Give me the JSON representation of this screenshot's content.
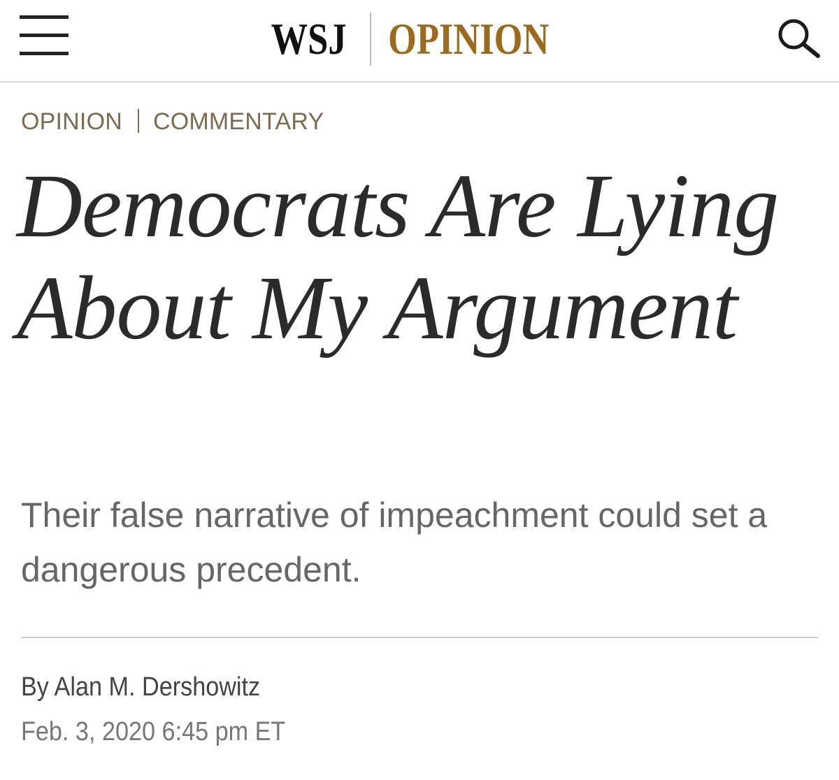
{
  "header": {
    "logo_primary": "WSJ",
    "logo_section": "OPINION",
    "menu_icon": "hamburger-menu-icon",
    "search_icon": "search-icon"
  },
  "breadcrumb": {
    "section": "OPINION",
    "subsection": "COMMENTARY"
  },
  "article": {
    "headline": "Democrats Are Lying About My Argument",
    "dek": "Their false narrative of impeachment could set a dangerous precedent.",
    "byline_prefix": "By",
    "author": "Alan M. Dershowitz",
    "timestamp": "Feb. 3, 2020 6:45 pm ET"
  },
  "colors": {
    "brand_gold": "#9b6a1f",
    "breadcrumb": "#7e6a4e",
    "headline": "#2b2b2b"
  }
}
